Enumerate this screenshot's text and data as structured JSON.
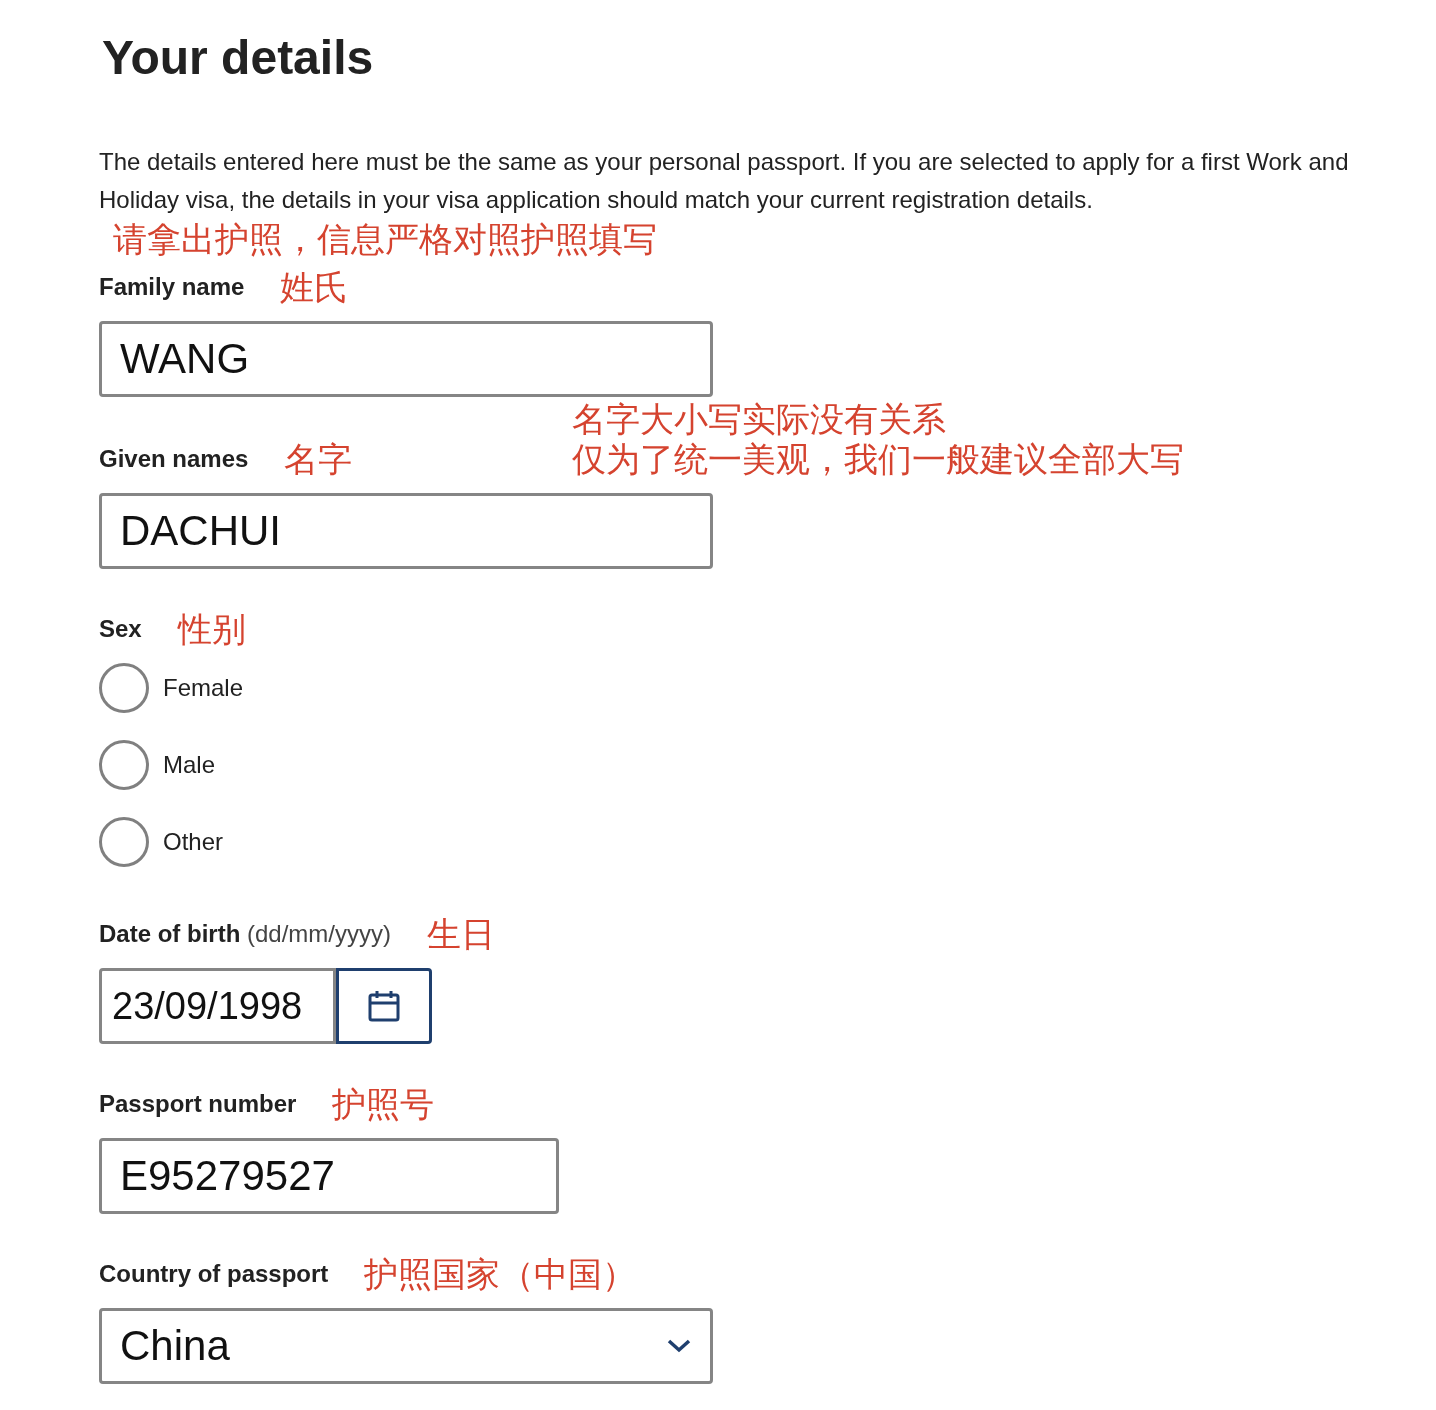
{
  "heading": "Your details",
  "intro": "The details entered here must be the same as your personal passport. If you are selected to apply for a first Work and Holiday visa, the details in your visa application should match your current registration details.",
  "intro_note": "请拿出护照，信息严格对照护照填写",
  "fields": [
    {
      "kind": "text",
      "label": "Family name",
      "note": "姓氏",
      "value": "WANG"
    },
    {
      "kind": "text",
      "label": "Given names",
      "note": "名字",
      "side_note": [
        "名字大小写实际没有关系",
        "仅为了统一美观，我们一般建议全部大写"
      ],
      "value": "DACHUI"
    },
    {
      "kind": "radio",
      "label": "Sex",
      "note": "性别",
      "options": [
        {
          "label": "Female",
          "selected": false
        },
        {
          "label": "Male",
          "selected": false
        },
        {
          "label": "Other",
          "selected": false
        }
      ]
    },
    {
      "kind": "date",
      "label": "Date of birth",
      "hint": "(dd/mm/yyyy)",
      "note": "生日",
      "value": "23/09/1998"
    },
    {
      "kind": "short",
      "label": "Passport number",
      "note": "护照号",
      "value": "E95279527"
    },
    {
      "kind": "select",
      "label": "Country of passport",
      "note": "护照国家（中国）",
      "value": "China"
    }
  ]
}
